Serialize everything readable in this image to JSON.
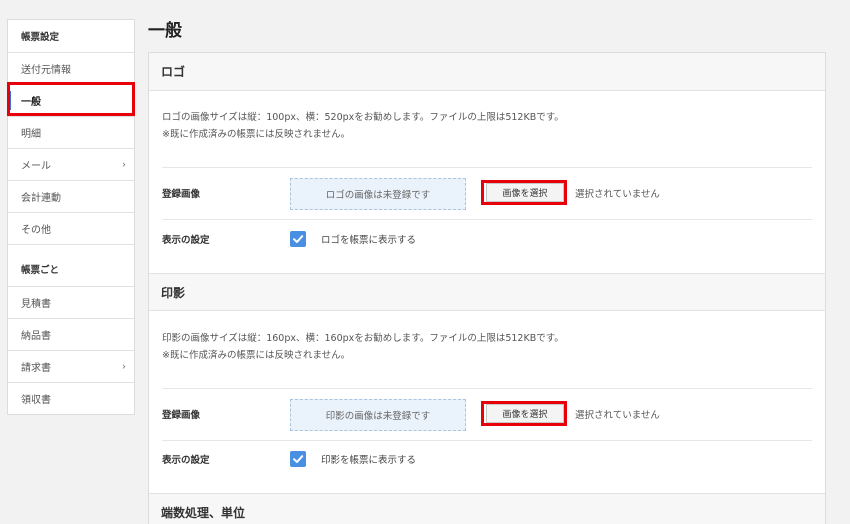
{
  "page_title": "一般",
  "sidebar": {
    "items": [
      {
        "label": "帳票設定",
        "type": "header"
      },
      {
        "label": "送付元情報"
      },
      {
        "label": "一般",
        "active": true
      },
      {
        "label": "明細"
      },
      {
        "label": "メール",
        "chevron": "›"
      },
      {
        "label": "会計連動"
      },
      {
        "label": "その他"
      },
      {
        "label": "帳票ごと",
        "type": "header"
      },
      {
        "label": "見積書"
      },
      {
        "label": "納品書"
      },
      {
        "label": "請求書",
        "chevron": "›"
      },
      {
        "label": "領収書"
      }
    ]
  },
  "sections": {
    "logo": {
      "title": "ロゴ",
      "note_line1": "ロゴの画像サイズは縦：100px、横：520pxをお勧めします。ファイルの上限は512KBです。",
      "note_line2": "※既に作成済みの帳票には反映されません。",
      "image_label": "登録画像",
      "placeholder": "ロゴの画像は未登録です",
      "select_button": "画像を選択",
      "status": "選択されていません",
      "display_label": "表示の設定",
      "checkbox_label": "ロゴを帳票に表示する",
      "checked": true
    },
    "seal": {
      "title": "印影",
      "note_line1": "印影の画像サイズは縦：160px、横：160pxをお勧めします。ファイルの上限は512KBです。",
      "note_line2": "※既に作成済みの帳票には反映されません。",
      "image_label": "登録画像",
      "placeholder": "印影の画像は未登録です",
      "select_button": "画像を選択",
      "status": "選択されていません",
      "display_label": "表示の設定",
      "checkbox_label": "印影を帳票に表示する",
      "checked": true
    },
    "rounding": {
      "title": "端数処理、単位"
    }
  },
  "colors": {
    "accent": "#4a90e2",
    "highlight": "#e8000b",
    "active_bar": "#3a6fd8"
  }
}
